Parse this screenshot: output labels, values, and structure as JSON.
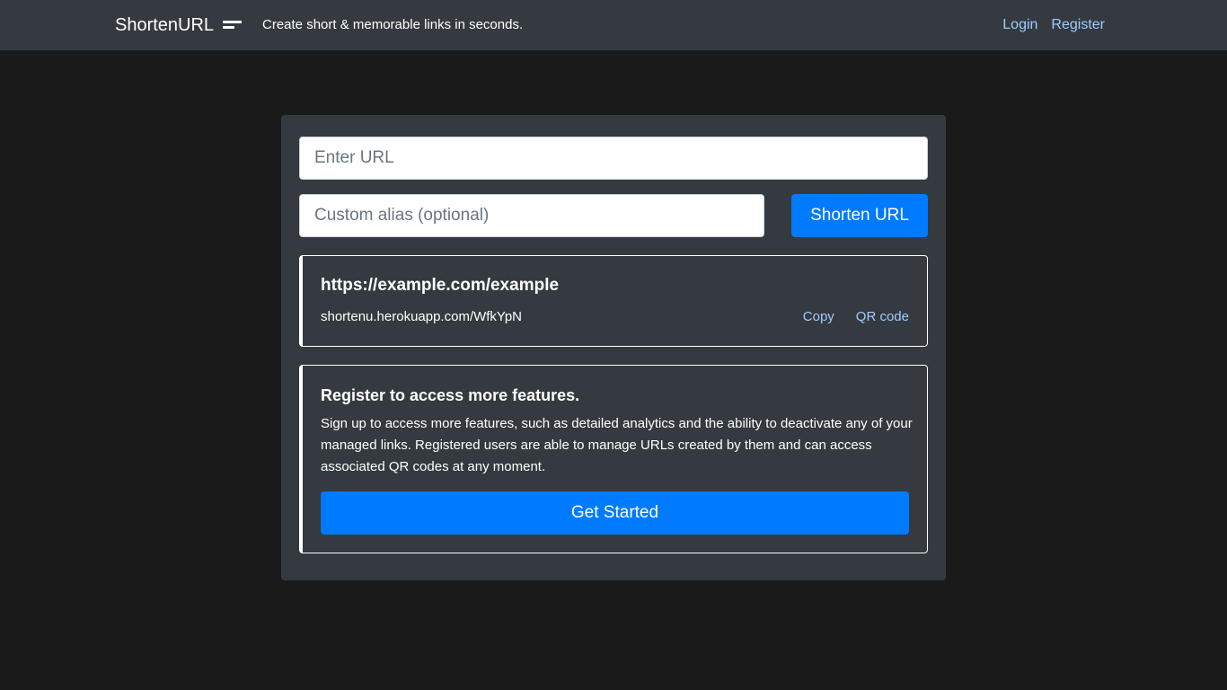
{
  "navbar": {
    "brand": "ShortenURL",
    "brand_icon": "menu-lines-icon",
    "tagline": "Create short & memorable links in seconds.",
    "login_label": "Login",
    "register_label": "Register"
  },
  "form": {
    "url_placeholder": "Enter URL",
    "url_value": "",
    "alias_placeholder": "Custom alias (optional)",
    "alias_value": "",
    "shorten_label": "Shorten URL"
  },
  "result": {
    "long_url": "https://example.com/example",
    "short_url": "shortenu.herokuapp.com/WfkYpN",
    "copy_label": "Copy",
    "qr_label": "QR code"
  },
  "promo": {
    "title": "Register to access more features.",
    "text": "Sign up to access more features, such as detailed analytics and the ability to deactivate any of your managed links. Registered users are able to manage URLs created by them and can access associated QR codes at any moment.",
    "cta_label": "Get Started"
  },
  "colors": {
    "background": "#1a1a1b",
    "navbar": "#343a40",
    "primary": "#007bff",
    "link": "#9ecbff"
  }
}
